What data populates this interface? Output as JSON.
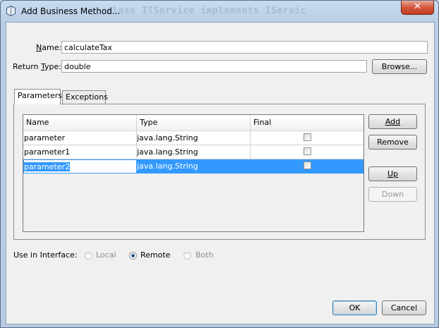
{
  "window": {
    "title": "Add Business Method...",
    "ghost_text": "class ITService implements IServic",
    "close_label": "✕"
  },
  "form": {
    "name_label": "Name:",
    "name_value": "calculateTax",
    "return_type_label": "Return Type:",
    "return_type_value": "double",
    "browse_label": "Browse..."
  },
  "tabs": [
    {
      "label": "Parameters",
      "active": true
    },
    {
      "label": "Exceptions",
      "active": false
    }
  ],
  "table": {
    "columns": [
      "Name",
      "Type",
      "Final"
    ],
    "rows": [
      {
        "name": "parameter",
        "type": "java.lang.String",
        "final": false
      },
      {
        "name": "parameter1",
        "type": "java.lang.String",
        "final": false
      },
      {
        "name": "parameter2",
        "type": "java.lang.String",
        "final": false,
        "selected": true
      }
    ]
  },
  "side_buttons": {
    "add": "Add",
    "remove": "Remove",
    "up": "Up",
    "down": "Down"
  },
  "interface": {
    "label": "Use in Interface:",
    "options": [
      "Local",
      "Remote",
      "Both"
    ],
    "selected": "Remote"
  },
  "footer": {
    "ok": "OK",
    "cancel": "Cancel"
  },
  "colors": {
    "selection": "#3399ff",
    "title_bar": "#c9dbef",
    "close_button": "#c23b22"
  },
  "icons": {
    "title": "window-app-icon"
  }
}
